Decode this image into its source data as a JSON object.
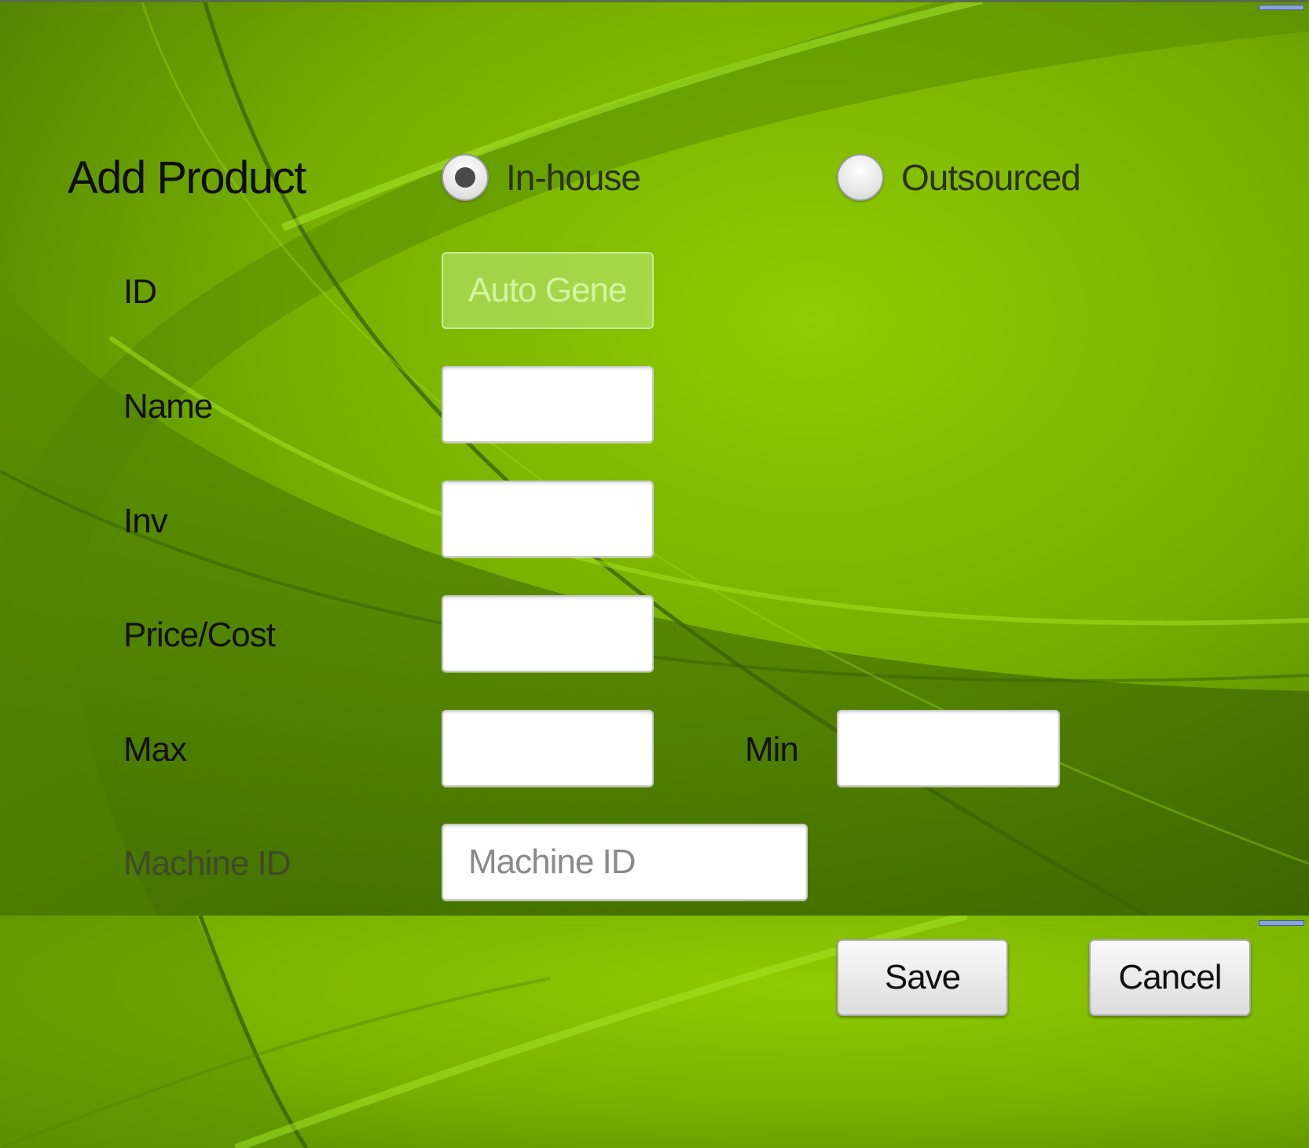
{
  "form": {
    "title": "Add Product",
    "source_options": [
      {
        "label": "In-house",
        "selected": true
      },
      {
        "label": "Outsourced",
        "selected": false
      }
    ],
    "fields": {
      "id": {
        "label": "ID",
        "placeholder": "Auto Gene",
        "value": "",
        "disabled": true
      },
      "name": {
        "label": "Name",
        "value": ""
      },
      "inv": {
        "label": "Inv",
        "value": ""
      },
      "price": {
        "label": "Price/Cost",
        "value": ""
      },
      "max": {
        "label": "Max",
        "value": ""
      },
      "min": {
        "label": "Min",
        "value": ""
      },
      "machine_id": {
        "label": "Machine ID",
        "placeholder": "Machine ID",
        "value": ""
      }
    }
  },
  "actions": {
    "save_label": "Save",
    "cancel_label": "Cancel"
  },
  "colors": {
    "background_light": "#8cc800",
    "background_dark": "#3f6a00"
  }
}
